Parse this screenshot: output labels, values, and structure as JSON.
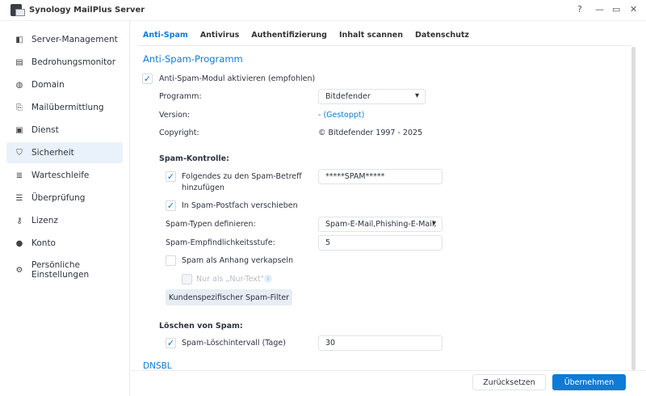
{
  "window": {
    "title": "Synology MailPlus Server",
    "help": "?",
    "minimize": "—",
    "maximize": "▭",
    "close": "✕"
  },
  "sidebar": {
    "items": [
      {
        "label": "Server-Management",
        "icon": "server-icon",
        "glyph": "◧"
      },
      {
        "label": "Bedrohungsmonitor",
        "icon": "monitor-icon",
        "glyph": "▤"
      },
      {
        "label": "Domain",
        "icon": "globe-icon",
        "glyph": "◍"
      },
      {
        "label": "Mailübermittlung",
        "icon": "mail-transfer-icon",
        "glyph": "⎘"
      },
      {
        "label": "Dienst",
        "icon": "service-icon",
        "glyph": "▣"
      },
      {
        "label": "Sicherheit",
        "icon": "shield-icon",
        "glyph": "⛉"
      },
      {
        "label": "Warteschleife",
        "icon": "queue-icon",
        "glyph": "≣"
      },
      {
        "label": "Überprüfung",
        "icon": "list-icon",
        "glyph": "☰"
      },
      {
        "label": "Lizenz",
        "icon": "key-icon",
        "glyph": "⚷"
      },
      {
        "label": "Konto",
        "icon": "user-icon",
        "glyph": "●"
      },
      {
        "label": "Persönliche Einstellungen",
        "icon": "gear-icon",
        "glyph": "⚙"
      }
    ]
  },
  "tabs": [
    "Anti-Spam",
    "Antivirus",
    "Authentifizierung",
    "Inhalt scannen",
    "Datenschutz"
  ],
  "main": {
    "section_title": "Anti-Spam-Programm",
    "enable_label": "Anti-Spam-Modul aktivieren (empfohlen)",
    "program_label": "Programm:",
    "program_value": "Bitdefender",
    "version_label": "Version:",
    "version_value": "- (Gestoppt)",
    "copyright_label": "Copyright:",
    "copyright_value": "© Bitdefender 1997 - 2025",
    "spam_control_title": "Spam-Kontrolle:",
    "subject_label": "Folgendes zu den Spam-Betreff hinzufügen",
    "subject_value": "*****SPAM*****",
    "move_label": "In Spam-Postfach verschieben",
    "types_label": "Spam-Typen definieren:",
    "types_value": "Spam-E-Mail,Phishing-E-Mail,",
    "sensitivity_label": "Spam-Empfindlichkeitsstufe:",
    "sensitivity_value": "5",
    "attach_label": "Spam als Anhang verkapseln",
    "plaintext_label": "Nur als „Nur-Text\"",
    "custom_filter_button": "Kundenspezifischer Spam-Filter",
    "delete_title": "Löschen von Spam:",
    "delete_interval_label": "Spam-Löschintervall (Tage)",
    "delete_interval_value": "30",
    "dnsbl_title": "DNSBL"
  },
  "footer": {
    "reset": "Zurücksetzen",
    "apply": "Übernehmen"
  },
  "colors": {
    "accent": "#0e7bd6"
  }
}
